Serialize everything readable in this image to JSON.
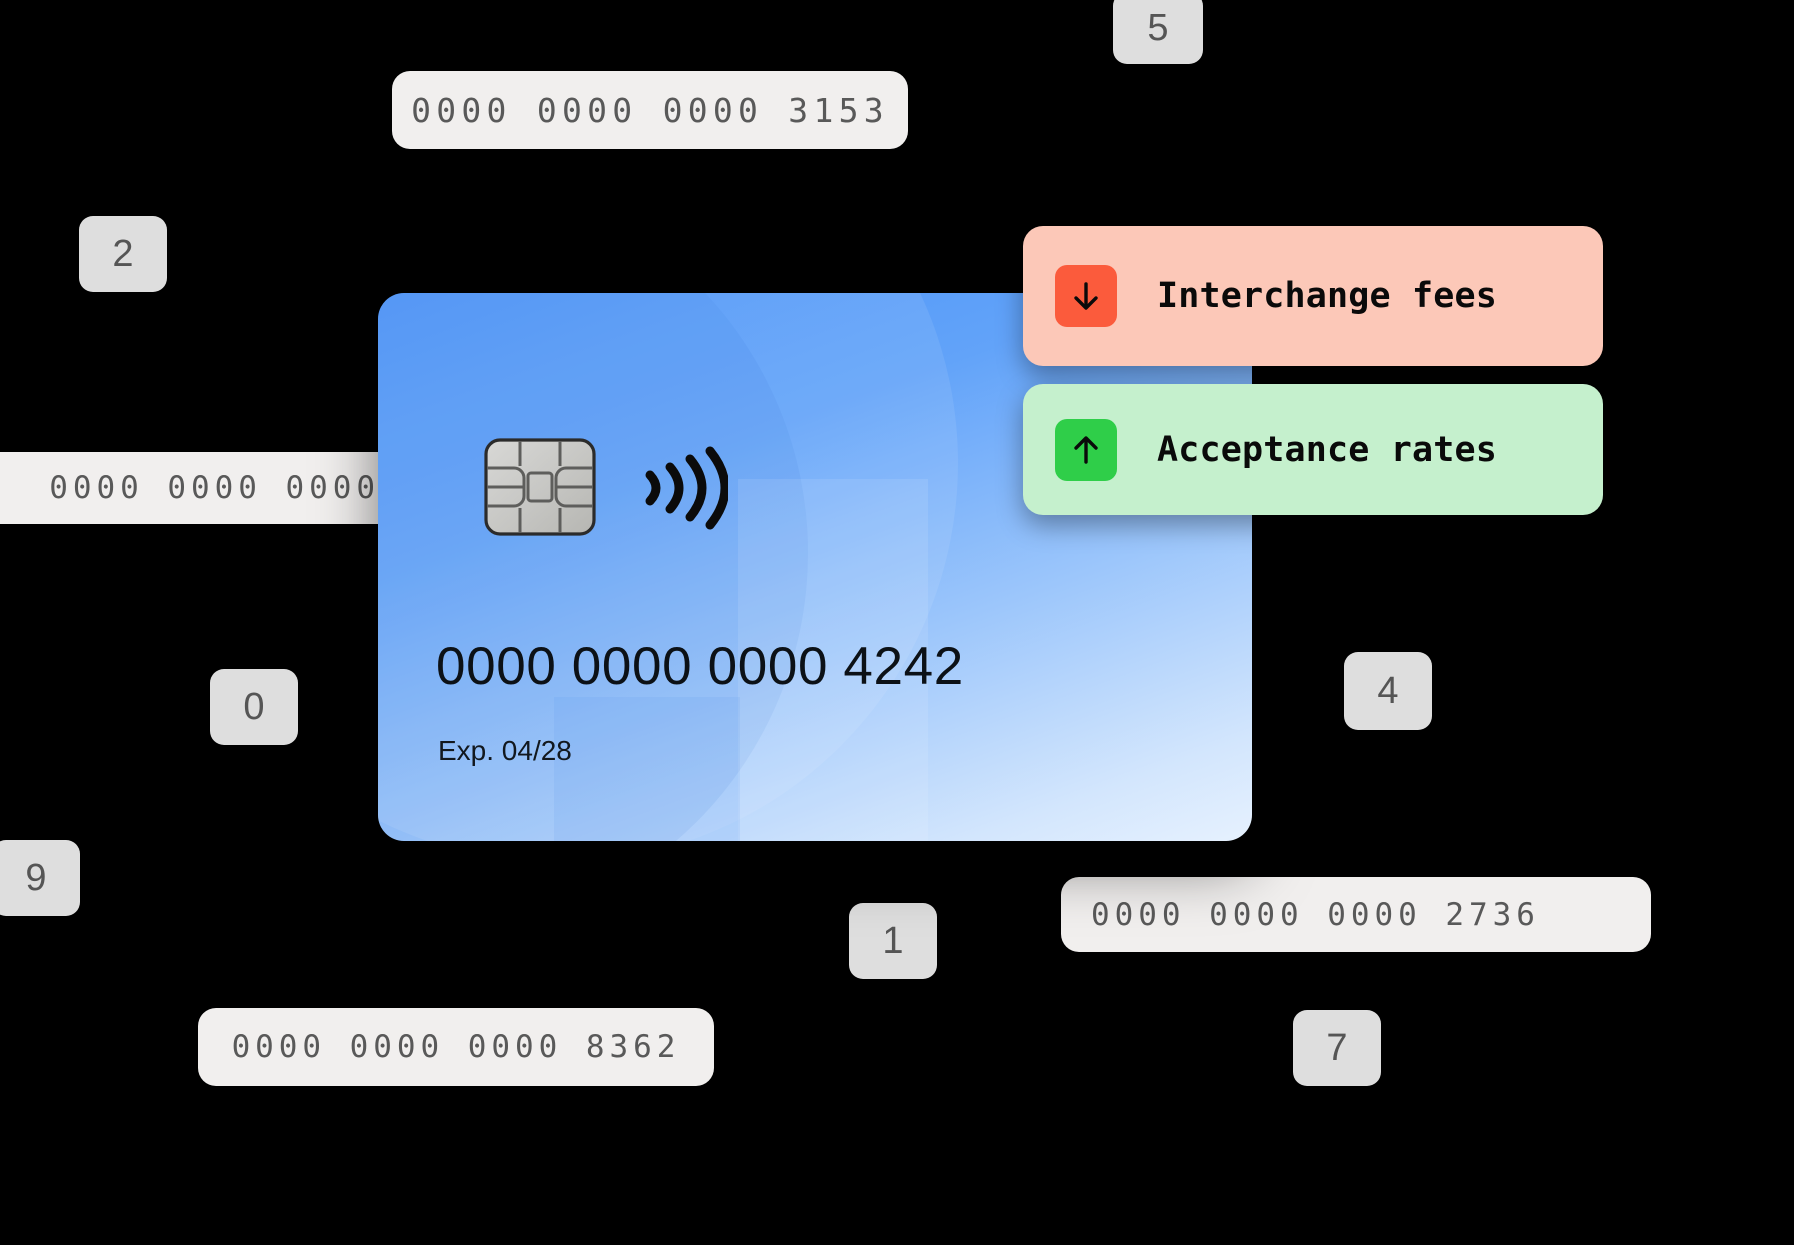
{
  "background_color": "#000000",
  "card": {
    "number": "0000 0000 0000 4242",
    "expiry_label": "Exp. 04/28",
    "chip_icon": "emv-chip-icon",
    "contactless_icon": "contactless-wave-icon",
    "gradient_from": "#4a93f8",
    "gradient_to": "#e6f1fe"
  },
  "badges": [
    {
      "label": "Interchange fees",
      "icon": "arrow-down-icon",
      "background": "#fcc8b8",
      "icon_background": "#fb5b3c",
      "icon_glyph": "↓"
    },
    {
      "label": "Acceptance rates",
      "icon": "arrow-up-icon",
      "background": "#c5f0cd",
      "icon_background": "#2fce49",
      "icon_glyph": "↑"
    }
  ],
  "number_pills": [
    {
      "text": "0000 0000 0000 3153",
      "id": "pill-top"
    },
    {
      "text": "0000 0000 0000",
      "id": "pill-left"
    },
    {
      "text": "0000 0000 0000 2736",
      "id": "pill-bottom-right"
    },
    {
      "text": "0000 0000 0000 8362",
      "id": "pill-bottom-left"
    }
  ],
  "digit_tiles": [
    {
      "digit": "5",
      "id": "tile-5"
    },
    {
      "digit": "2",
      "id": "tile-2"
    },
    {
      "digit": "0",
      "id": "tile-0"
    },
    {
      "digit": "4",
      "id": "tile-4"
    },
    {
      "digit": "9",
      "id": "tile-9"
    },
    {
      "digit": "1",
      "id": "tile-1"
    },
    {
      "digit": "7",
      "id": "tile-7"
    }
  ],
  "colors": {
    "pill_background": "#f1efee",
    "pill_text": "#595959",
    "tile_background": "#dedede",
    "tile_text": "#555555"
  }
}
